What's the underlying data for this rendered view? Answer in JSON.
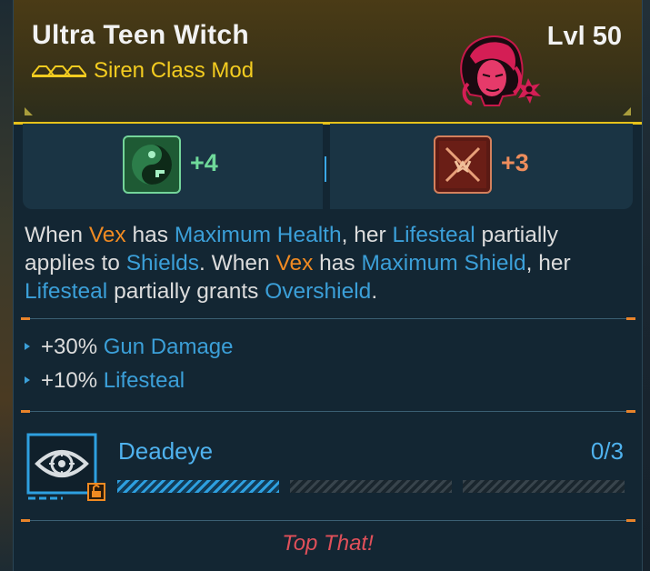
{
  "item": {
    "name": "Ultra Teen Witch",
    "level": "Lvl 50",
    "type": "Siren Class Mod",
    "rarity_icon": "legendary-chevrons-icon",
    "portrait_icon": "vex-portrait-icon",
    "accent_color": "#e7c21a"
  },
  "skills": [
    {
      "icon": "dead-ringer-skill-icon",
      "value": "+4",
      "color": "#6fd99a"
    },
    {
      "icon": "trauma-bond-skill-icon",
      "value": "+3",
      "color": "#ee8d5c"
    }
  ],
  "description": {
    "s1": "When ",
    "s2": "Vex",
    "s3": " has ",
    "s4": "Maximum Health",
    "s5": ", her ",
    "s6": "Lifesteal",
    "s7": " partially applies to ",
    "s8": "Shields",
    "s9": ". When ",
    "s10": "Vex",
    "s11": " has ",
    "s12": "Maximum Shield",
    "s13": ", her ",
    "s14": "Lifesteal",
    "s15": " partially grants ",
    "s16": "Overshield",
    "s17": "."
  },
  "stats": [
    {
      "amount": "+30%",
      "name": "Gun Damage"
    },
    {
      "amount": "+10%",
      "name": "Lifesteal"
    }
  ],
  "augment": {
    "name": "Deadeye",
    "count": "0/3",
    "progress_filled_segments": 1,
    "total_segments": 3,
    "icon": "eye-target-icon",
    "lock_icon": "unlocked-padlock-icon"
  },
  "flavor_text": "Top That!"
}
